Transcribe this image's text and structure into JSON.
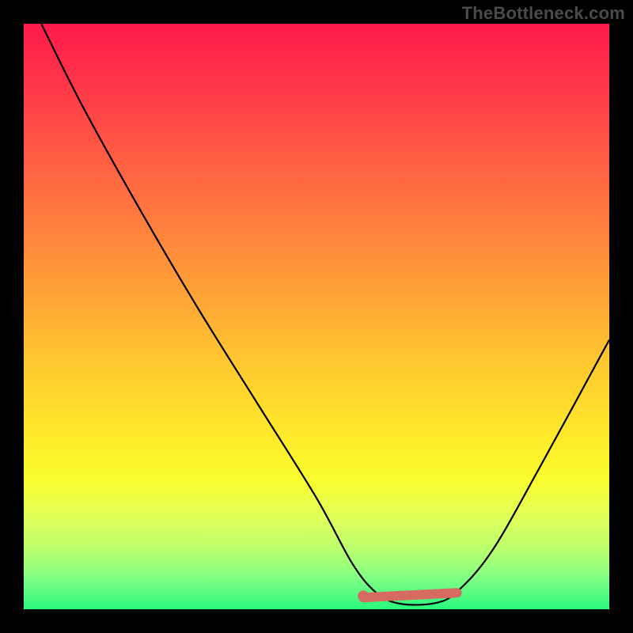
{
  "watermark": "TheBottleneck.com",
  "chart_data": {
    "type": "line",
    "title": "",
    "xlabel": "",
    "ylabel": "",
    "xlim": [
      0,
      100
    ],
    "ylim": [
      0,
      100
    ],
    "grid": false,
    "series": [
      {
        "name": "bottleneck-curve",
        "x": [
          3,
          10,
          20,
          30,
          40,
          50,
          56,
          60,
          64,
          70,
          74,
          80,
          88,
          100
        ],
        "y": [
          100,
          86,
          68,
          51,
          35,
          19,
          8,
          3,
          1,
          1,
          3,
          10,
          24,
          46
        ]
      }
    ],
    "sweet_spot": {
      "x_start": 58,
      "x_end": 74,
      "y": 2
    },
    "background": "heat-gradient-green-to-red",
    "colors": {
      "curve": "#000000",
      "sweet_spot": "#d66b62",
      "frame": "#000000"
    }
  }
}
